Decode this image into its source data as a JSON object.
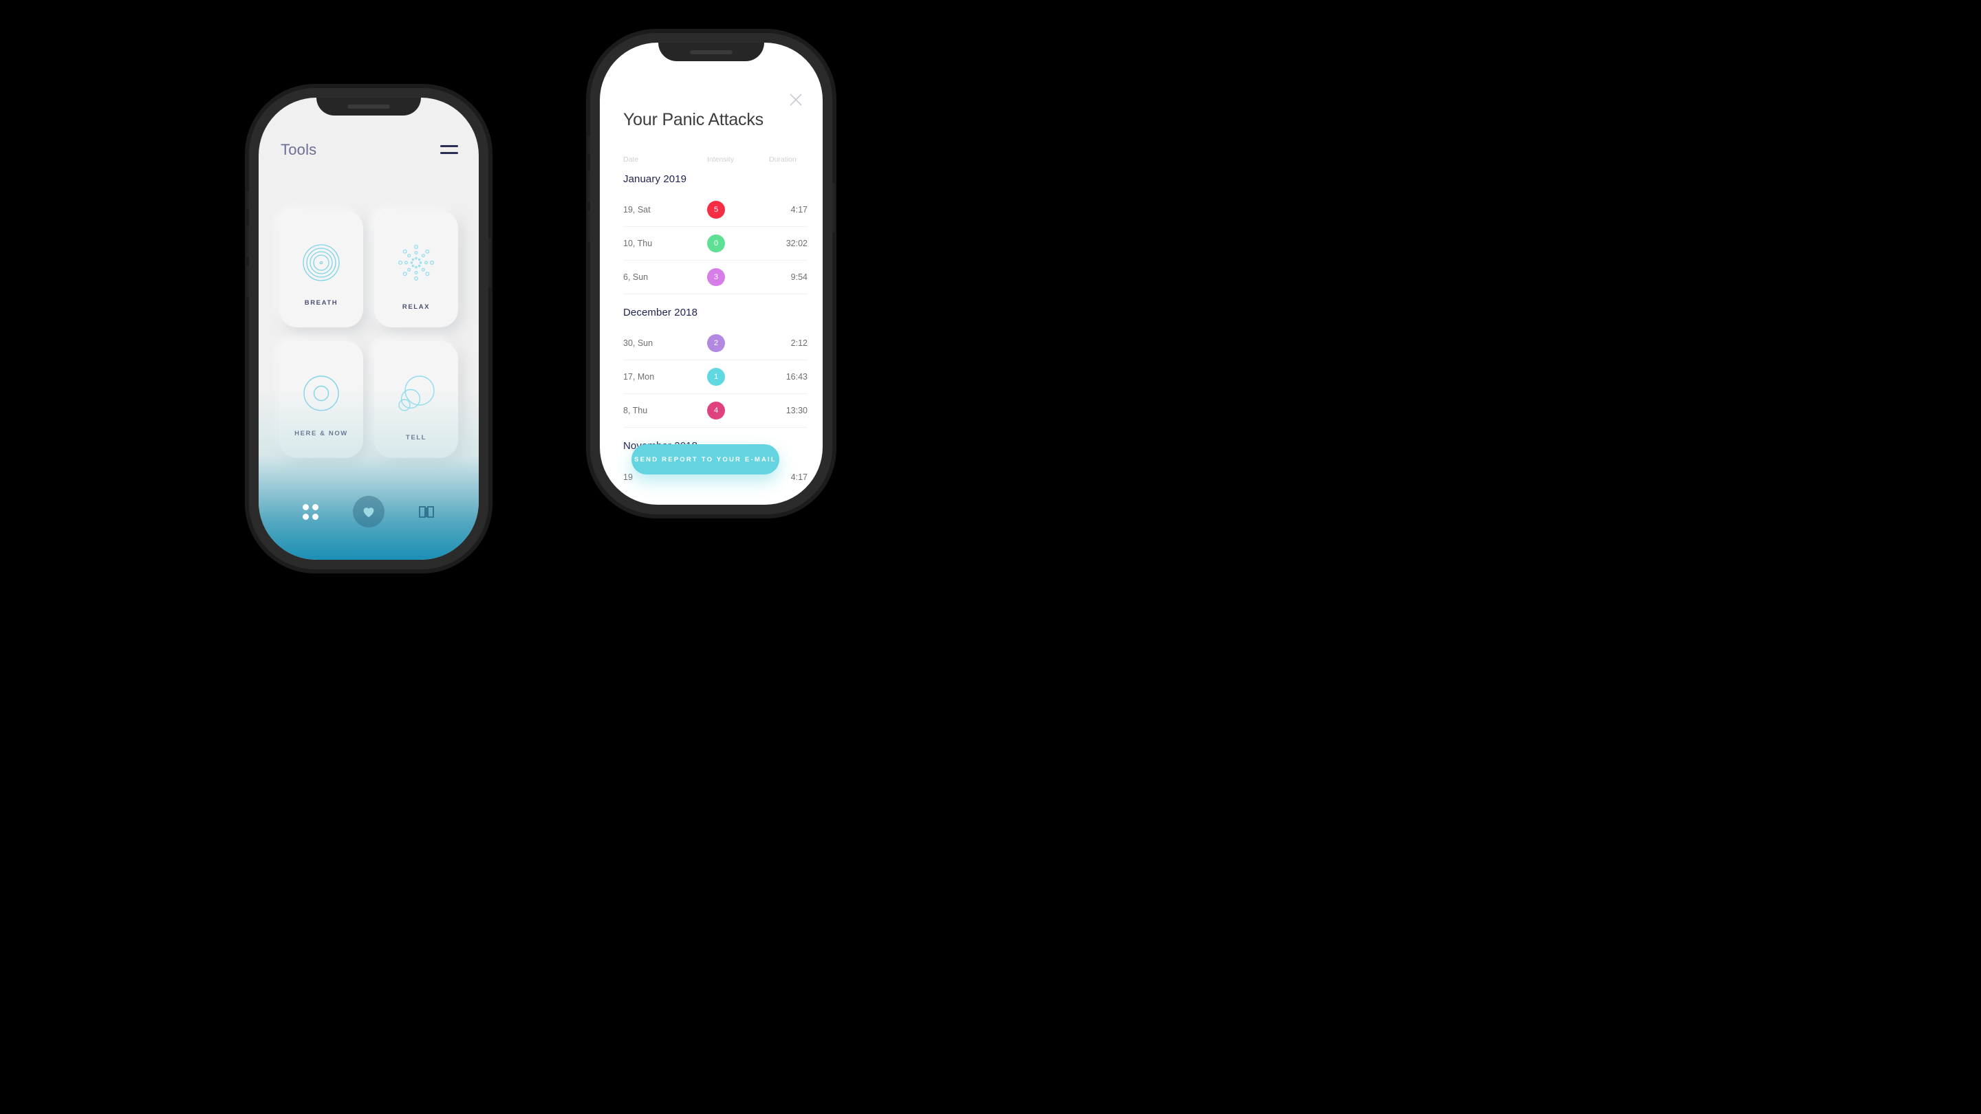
{
  "background_color": "#000000",
  "left_phone": {
    "header": {
      "title": "Tools",
      "menu_icon": "hamburger-icon"
    },
    "tools": [
      {
        "label": "BREATH",
        "icon": "concentric-rings-icon"
      },
      {
        "label": "RELAX",
        "icon": "radial-dots-burst-icon"
      },
      {
        "label": "HERE & NOW",
        "icon": "double-circle-icon"
      },
      {
        "label": "TELL",
        "icon": "overlapping-circles-icon"
      }
    ],
    "tabbar": [
      {
        "name": "grid-icon",
        "active": false
      },
      {
        "name": "heart-icon",
        "active": true
      },
      {
        "name": "book-icon",
        "active": false
      }
    ],
    "accent_color": "#7fd4e8",
    "label_color": "#4a4f73",
    "title_color": "#6b6f96",
    "gradient_bottom_color": "#1b8fb5"
  },
  "right_phone": {
    "close_label": "×",
    "title": "Your Panic Attacks",
    "columns": {
      "date": "Date",
      "intensity": "Intensity",
      "duration": "Duration"
    },
    "send_button": "SEND REPORT TO YOUR E-MAIL",
    "send_button_color": "#63d4e0",
    "month_color": "#1e2150",
    "months": [
      {
        "label": "January 2019",
        "entries": [
          {
            "date": "19, Sat",
            "intensity": "5",
            "color": "#f52d45",
            "duration": "4:17"
          },
          {
            "date": "10, Thu",
            "intensity": "0",
            "color": "#5fe095",
            "duration": "32:02"
          },
          {
            "date": "6, Sun",
            "intensity": "3",
            "color": "#d77de8",
            "duration": "9:54"
          }
        ]
      },
      {
        "label": "December 2018",
        "entries": [
          {
            "date": "30, Sun",
            "intensity": "2",
            "color": "#b388e0",
            "duration": "2:12"
          },
          {
            "date": "17, Mon",
            "intensity": "1",
            "color": "#5fd8e0",
            "duration": "16:43"
          },
          {
            "date": "8, Thu",
            "intensity": "4",
            "color": "#e0417f",
            "duration": "13:30"
          }
        ]
      },
      {
        "label": "November 2018",
        "entries": [
          {
            "date": "19",
            "intensity": "",
            "color": "transparent",
            "duration": "4:17"
          }
        ]
      }
    ]
  }
}
